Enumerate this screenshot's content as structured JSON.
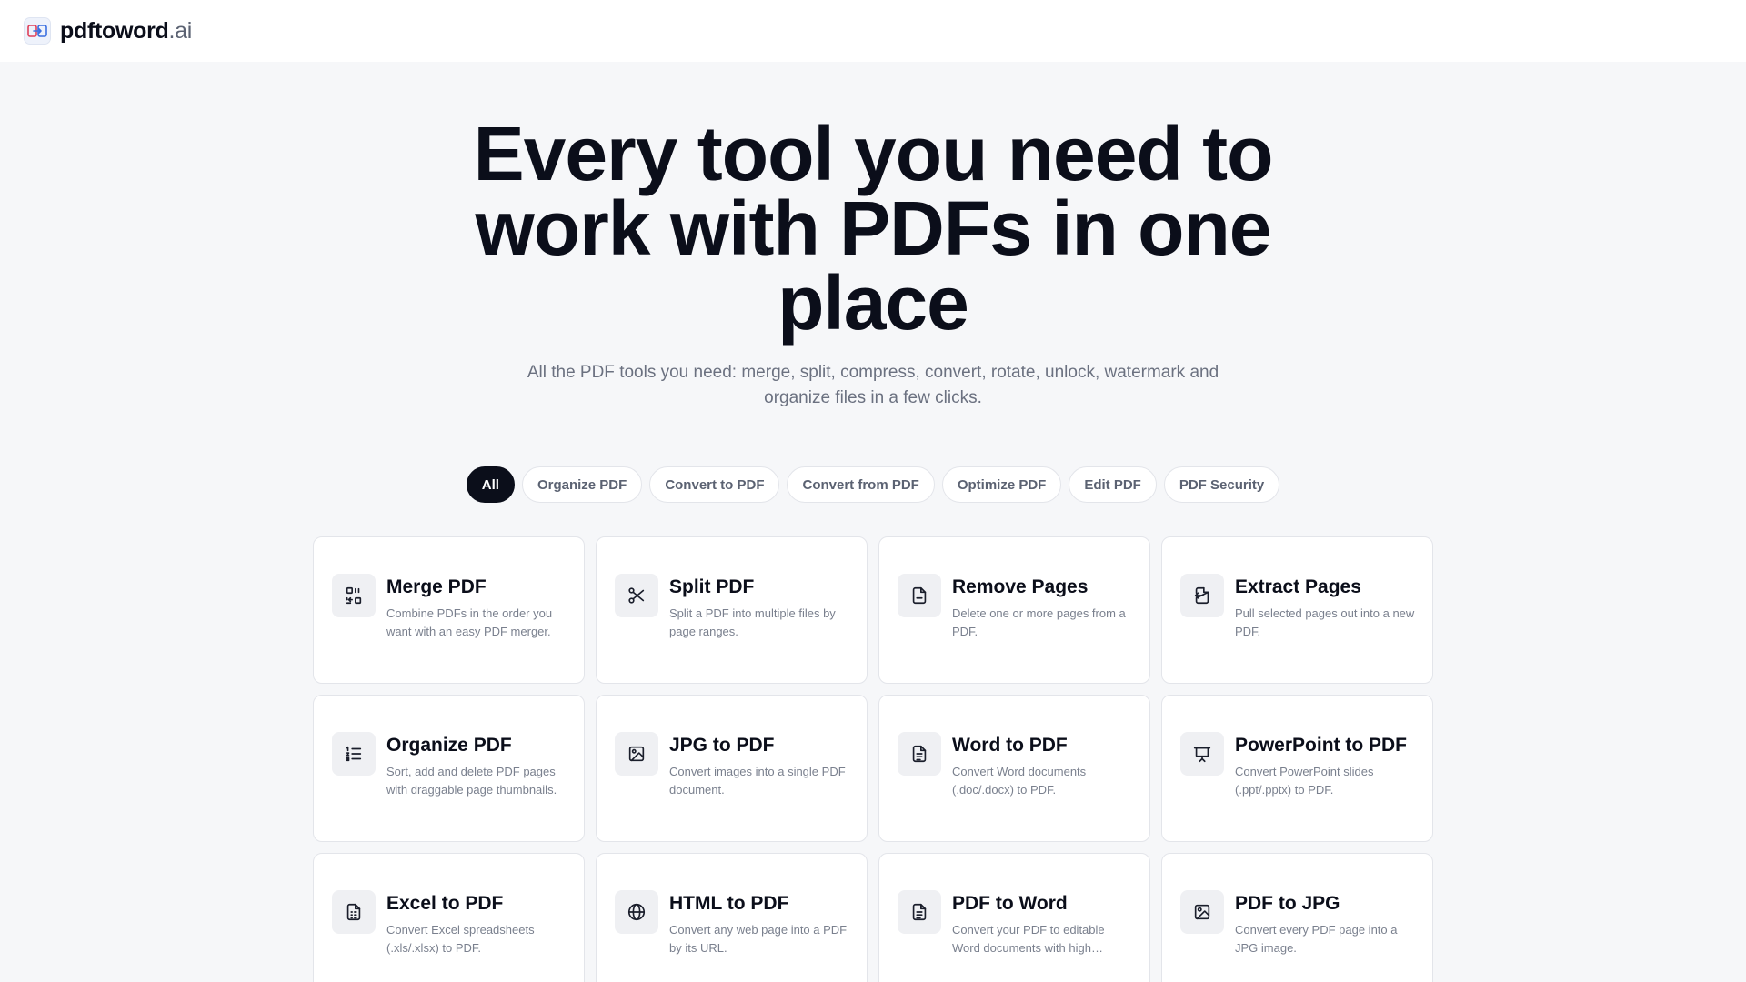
{
  "brand": {
    "name": "pdftoword",
    "tld": ".ai"
  },
  "hero": {
    "title": "Every tool you need to work with PDFs in one place",
    "subtitle": "All the PDF tools you need: merge, split, compress, convert, rotate, unlock, watermark and organize files in a few clicks."
  },
  "filters": [
    {
      "label": "All",
      "active": true
    },
    {
      "label": "Organize PDF"
    },
    {
      "label": "Convert to PDF"
    },
    {
      "label": "Convert from PDF"
    },
    {
      "label": "Optimize PDF"
    },
    {
      "label": "Edit PDF"
    },
    {
      "label": "PDF Security"
    }
  ],
  "tools": [
    {
      "title": "Merge PDF",
      "desc": "Combine PDFs in the order you want with an easy PDF merger.",
      "icon": "merge-icon"
    },
    {
      "title": "Split PDF",
      "desc": "Split a PDF into multiple files by page ranges.",
      "icon": "scissors-icon"
    },
    {
      "title": "Remove Pages",
      "desc": "Delete one or more pages from a PDF.",
      "icon": "file-icon"
    },
    {
      "title": "Extract Pages",
      "desc": "Pull selected pages out into a new PDF.",
      "icon": "file-export-icon"
    },
    {
      "title": "Organize PDF",
      "desc": "Sort, add and delete PDF pages with draggable page thumbnails.",
      "icon": "list-ordered-icon"
    },
    {
      "title": "JPG to PDF",
      "desc": "Convert images into a single PDF document.",
      "icon": "image-icon"
    },
    {
      "title": "Word to PDF",
      "desc": "Convert Word documents (.doc/.docx) to PDF.",
      "icon": "document-icon"
    },
    {
      "title": "PowerPoint to PDF",
      "desc": "Convert PowerPoint slides (.ppt/.pptx) to PDF.",
      "icon": "presentation-icon"
    },
    {
      "title": "Excel to PDF",
      "desc": "Convert Excel spreadsheets (.xls/.xlsx) to PDF.",
      "icon": "spreadsheet-icon"
    },
    {
      "title": "HTML to PDF",
      "desc": "Convert any web page into a PDF by its URL.",
      "icon": "globe-icon"
    },
    {
      "title": "PDF to Word",
      "desc": "Convert your PDF to editable Word documents with high accuracy.",
      "icon": "document-icon"
    },
    {
      "title": "PDF to JPG",
      "desc": "Convert every PDF page into a JPG image.",
      "icon": "image-icon"
    }
  ]
}
